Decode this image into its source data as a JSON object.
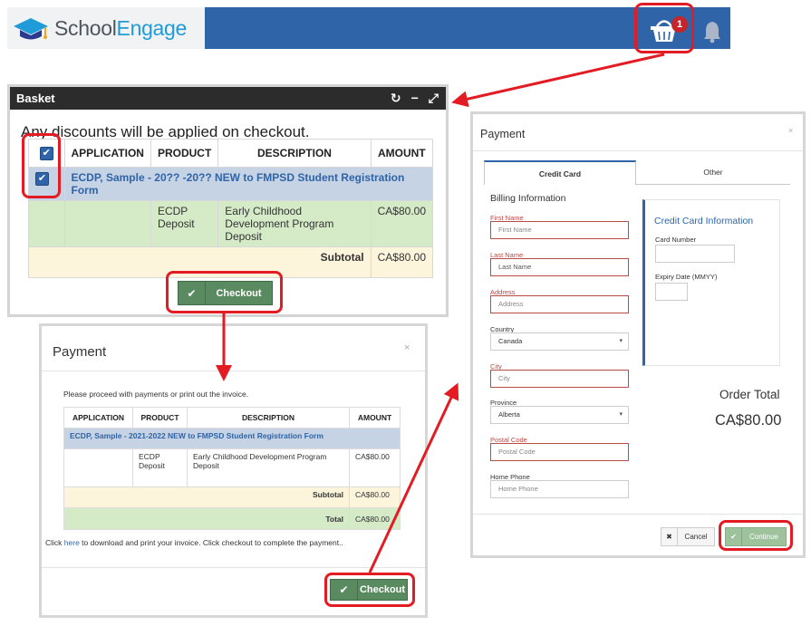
{
  "header": {
    "logo_school": "School",
    "logo_engage": "Engage",
    "basket_count": "1"
  },
  "basket": {
    "title": "Basket",
    "discount_note": "Any discounts will be applied on checkout.",
    "columns": [
      "APPLICATION",
      "PRODUCT",
      "DESCRIPTION",
      "AMOUNT"
    ],
    "application_row": "ECDP, Sample - 20?? -20?? NEW to FMPSD Student Registration Form",
    "item": {
      "product": "ECDP Deposit",
      "description": "Early Childhood Development Program Deposit",
      "amount": "CA$80.00"
    },
    "subtotal_label": "Subtotal",
    "subtotal_value": "CA$80.00",
    "checkout_label": "Checkout"
  },
  "payment_invoice": {
    "title": "Payment",
    "close": "×",
    "intro": "Please proceed with payments or print out the invoice.",
    "columns": [
      "APPLICATION",
      "PRODUCT",
      "DESCRIPTION",
      "AMOUNT"
    ],
    "application_row": "ECDP, Sample - 2021-2022 NEW to FMPSD Student Registration Form",
    "item": {
      "product": "ECDP Deposit",
      "description": "Early Childhood Development Program Deposit",
      "amount": "CA$80.00"
    },
    "subtotal_label": "Subtotal",
    "subtotal_value": "CA$80.00",
    "total_label": "Total",
    "total_value": "CA$80.00",
    "footer_before": "Click ",
    "footer_link": "here",
    "footer_after": " to download and print your invoice. Click checkout to complete the payment..",
    "checkout_label": "Checkout"
  },
  "payment_card": {
    "title": "Payment",
    "close": "×",
    "tabs": [
      "Credit Card",
      "Other"
    ],
    "billing_title": "Billing Information",
    "fields": {
      "first_name": {
        "label": "First Name",
        "placeholder": "First Name"
      },
      "last_name": {
        "label": "Last Name",
        "placeholder": "Last Name"
      },
      "address": {
        "label": "Address",
        "placeholder": "Address"
      },
      "country": {
        "label": "Country",
        "value": "Canada"
      },
      "city": {
        "label": "City",
        "placeholder": "City"
      },
      "province": {
        "label": "Province",
        "value": "Alberta"
      },
      "postal_code": {
        "label": "Postal Code",
        "placeholder": "Postal Code"
      },
      "home_phone": {
        "label": "Home Phone",
        "placeholder": "Home Phone"
      }
    },
    "credit_card": {
      "title": "Credit Card Information",
      "card_number_label": "Card Number",
      "expiry_label": "Expiry Date (MMYY)"
    },
    "order_total_label": "Order Total",
    "order_total_value": "CA$80.00",
    "cancel_label": "Cancel",
    "continue_label": "Continue"
  },
  "colors": {
    "brand_blue": "#2f64a8",
    "highlight_red": "#e31b23",
    "checkout_green": "#5a8a5f"
  }
}
